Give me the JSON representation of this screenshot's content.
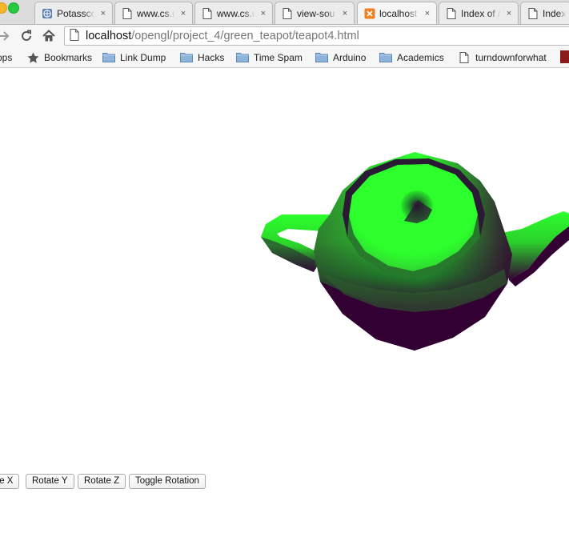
{
  "tabs": [
    {
      "title": "Potassco",
      "icon": "globe-icon",
      "active": false
    },
    {
      "title": "www.cs.u",
      "icon": "page-icon",
      "active": false
    },
    {
      "title": "www.cs.u",
      "icon": "page-icon",
      "active": false
    },
    {
      "title": "view-sou",
      "icon": "page-icon",
      "active": false
    },
    {
      "title": "localhost",
      "icon": "xampp-icon",
      "active": true
    },
    {
      "title": "Index of /",
      "icon": "page-icon",
      "active": false
    },
    {
      "title": "Index o",
      "icon": "page-icon",
      "active": false
    }
  ],
  "tab_close_glyph": "×",
  "address": {
    "host": "localhost",
    "path": "/opengl/project_4/green_teapot/teapot4.html"
  },
  "bookmarks": [
    {
      "label": "ops",
      "icon": "apps-icon"
    },
    {
      "label": "Bookmarks",
      "icon": "star-icon"
    },
    {
      "label": "Link Dump",
      "icon": "folder-icon"
    },
    {
      "label": "Hacks",
      "icon": "folder-icon"
    },
    {
      "label": "Time Spam",
      "icon": "folder-icon"
    },
    {
      "label": "Arduino",
      "icon": "folder-icon"
    },
    {
      "label": "Academics",
      "icon": "folder-icon"
    },
    {
      "label": "turndownforwhat",
      "icon": "page-icon"
    }
  ],
  "controls": {
    "rotate_x": "te X",
    "rotate_y": "Rotate Y",
    "rotate_z": "Rotate Z",
    "toggle": "Toggle Rotation"
  },
  "colors": {
    "teapot_highlight": "#2cff2c",
    "teapot_shadow": "#330033"
  }
}
